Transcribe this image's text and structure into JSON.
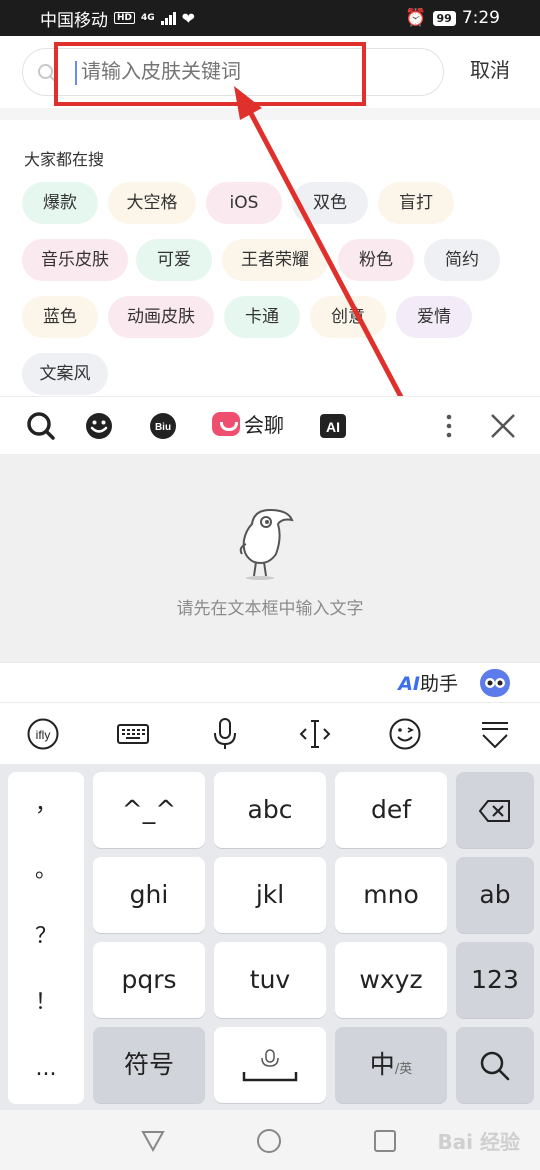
{
  "status_bar": {
    "carrier": "中国移动",
    "hd": "HD",
    "network": "4G",
    "battery": "99",
    "time": "7:29"
  },
  "search": {
    "placeholder": "请输入皮肤关键词",
    "cancel_label": "取消"
  },
  "hot": {
    "title": "大家都在搜",
    "tags": [
      "爆款",
      "大空格",
      "iOS",
      "双色",
      "盲打",
      "音乐皮肤",
      "可爱",
      "王者荣耀",
      "粉色",
      "简约",
      "蓝色",
      "动画皮肤",
      "卡通",
      "创意",
      "爱情",
      "文案风"
    ]
  },
  "toolbar": {
    "huiliao_label": "会聊",
    "ai_icon_text": "AI"
  },
  "panel": {
    "empty_text": "请先在文本框中输入文字"
  },
  "ai_bar": {
    "ai": "AI",
    "assistant": "助手"
  },
  "keyboard": {
    "side": [
      "，",
      "。",
      "？",
      "！",
      "..."
    ],
    "rows": [
      [
        "^_^",
        "abc",
        "def"
      ],
      [
        "ghi",
        "jkl",
        "mno",
        "ab"
      ],
      [
        "pqrs",
        "tuv",
        "wxyz",
        "123"
      ]
    ],
    "symbols": "符号",
    "zh": "中",
    "en": "/英"
  },
  "nav": {
    "watermark": "Bai 经验"
  },
  "colors": {
    "annotation_red": "#e0302c",
    "accent_blue": "#3b6ff0",
    "huiliao_pink": "#ef4f6e"
  }
}
